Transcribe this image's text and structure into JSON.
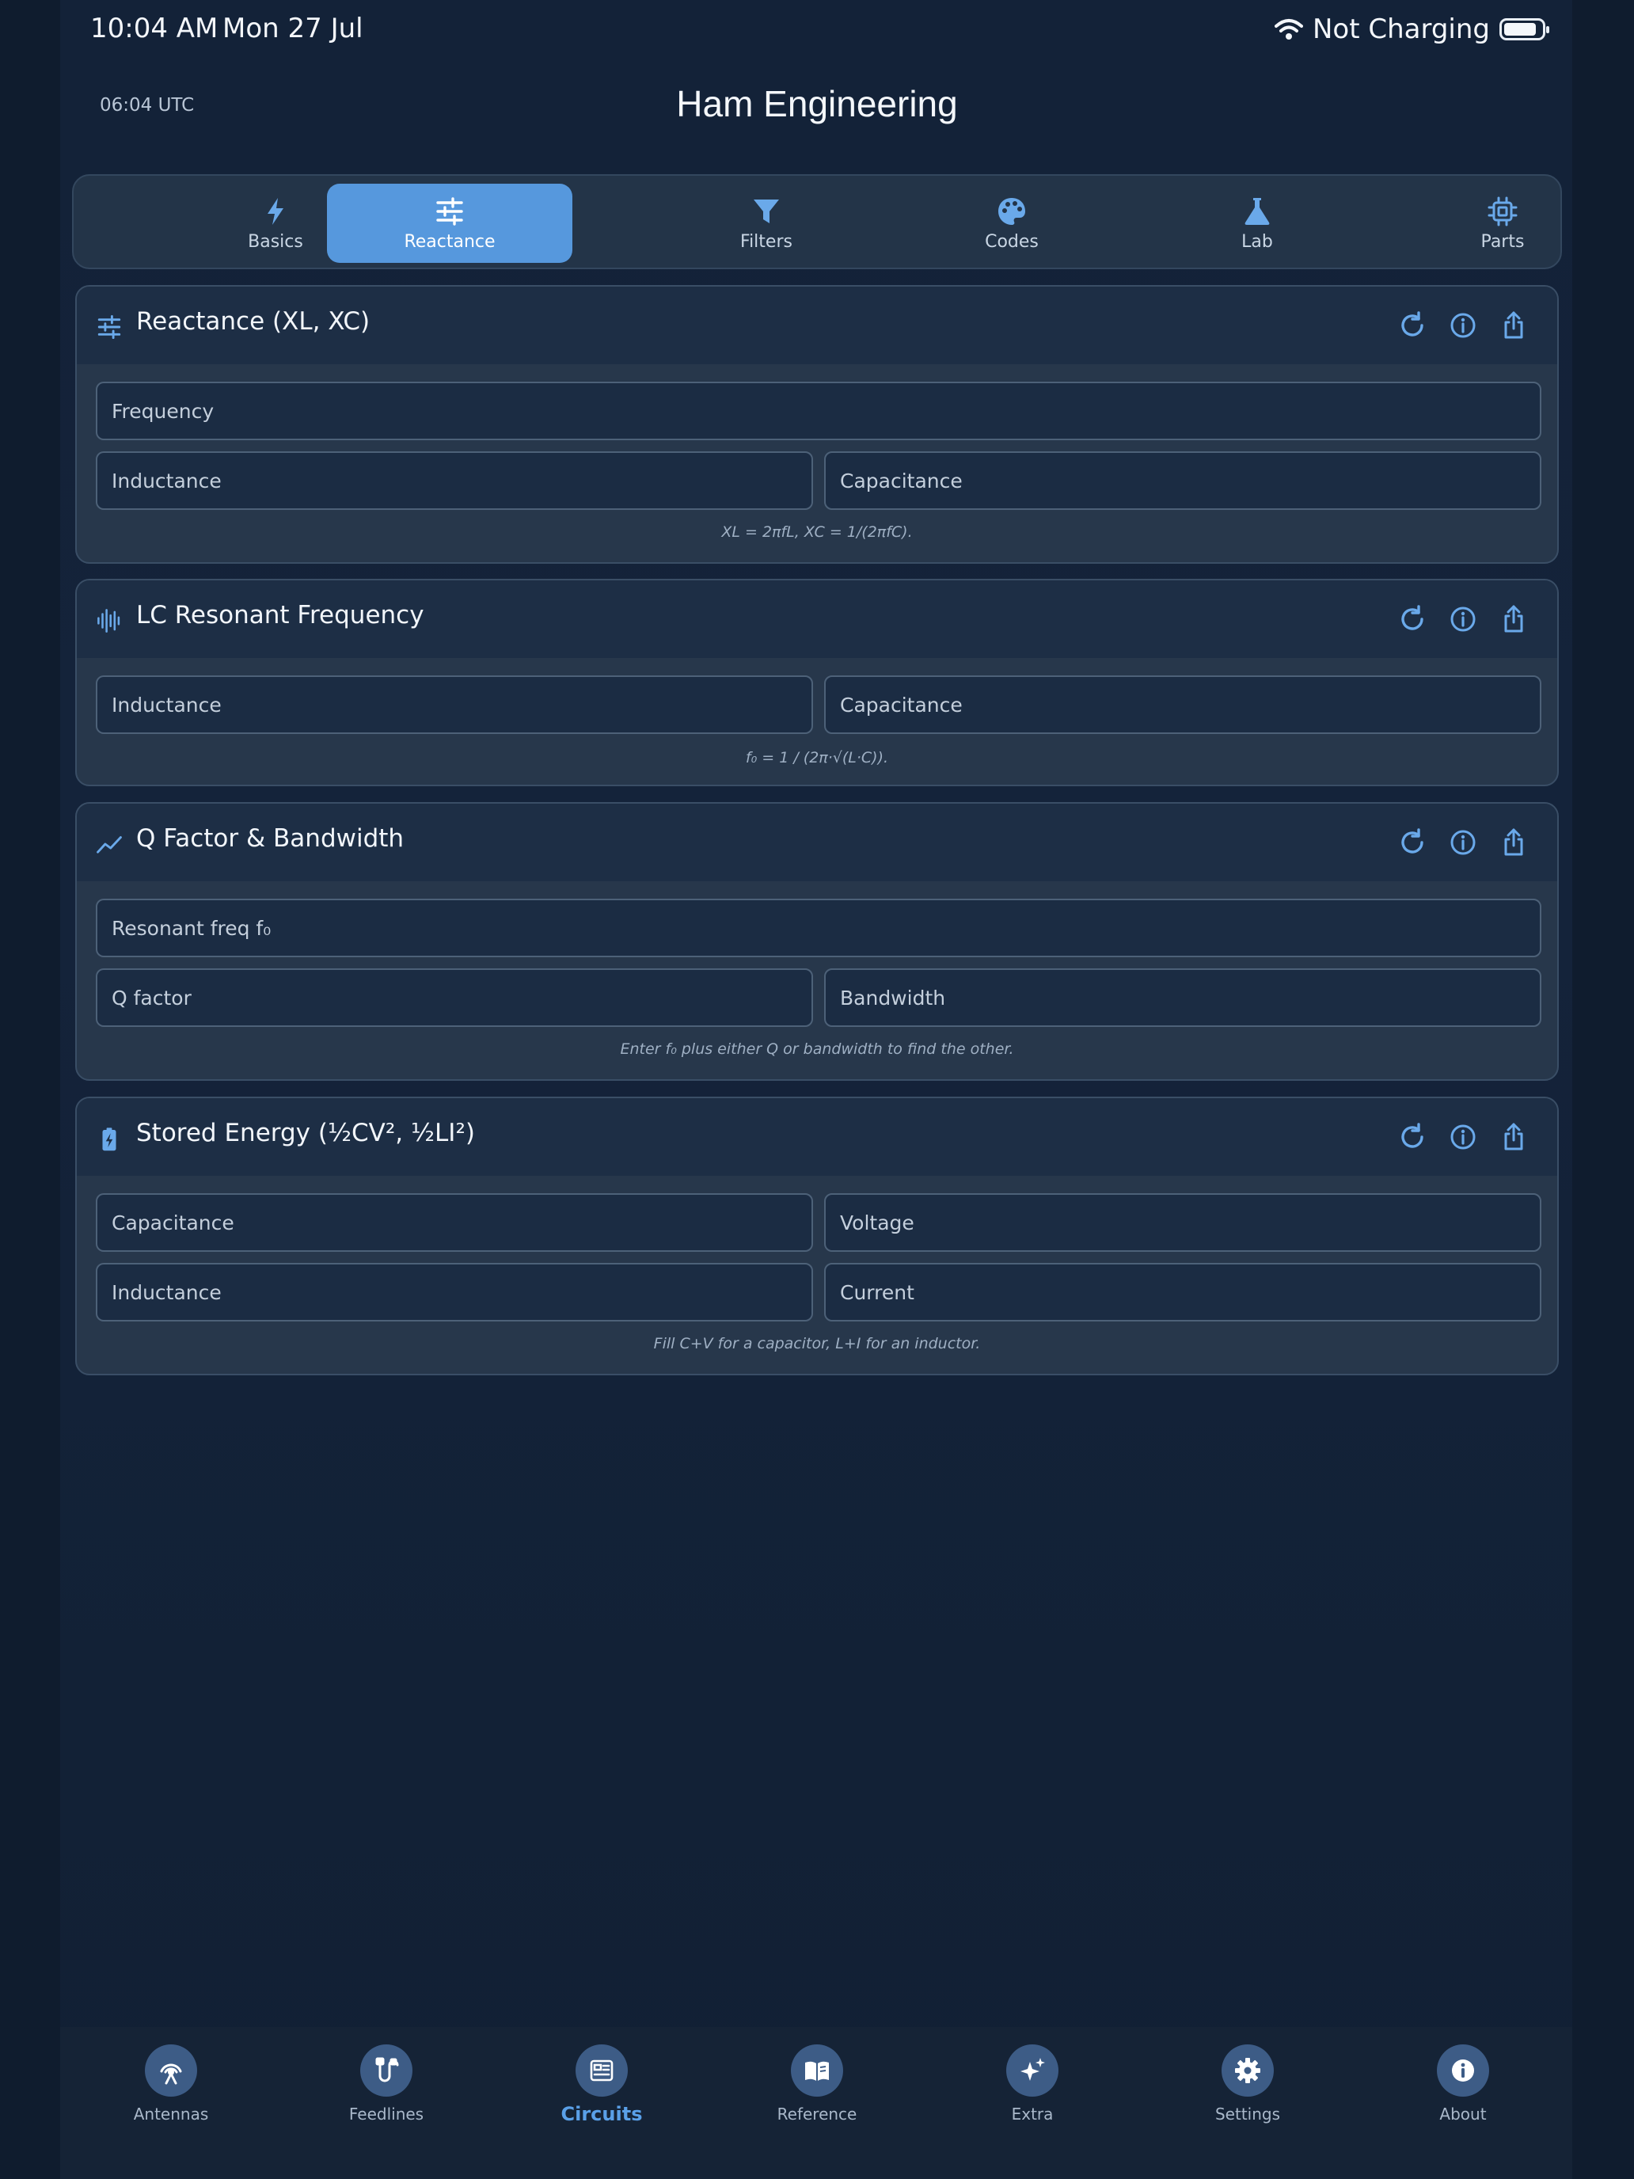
{
  "status_bar": {
    "time": "10:04 AM",
    "date": "Mon 27 Jul",
    "charging": "Not Charging"
  },
  "header": {
    "utc": "06:04 UTC",
    "title": "Ham Engineering"
  },
  "tabs": [
    {
      "label": "Basics",
      "icon": "bolt-icon"
    },
    {
      "label": "Reactance",
      "icon": "sliders-icon",
      "active": true
    },
    {
      "label": "Filters",
      "icon": "funnel-icon"
    },
    {
      "label": "Codes",
      "icon": "palette-icon"
    },
    {
      "label": "Lab",
      "icon": "flask-icon"
    },
    {
      "label": "Parts",
      "icon": "chip-icon"
    }
  ],
  "cards": [
    {
      "title": "Reactance  (XL, XC)",
      "icon": "sliders-icon",
      "fields": [
        "Frequency",
        "Inductance",
        "Capacitance"
      ],
      "hint": "XL = 2πfL,  XC = 1/(2πfC)."
    },
    {
      "title": "LC Resonant Frequency",
      "icon": "waveform-icon",
      "fields": [
        "Inductance",
        "Capacitance"
      ],
      "hint": "f₀ = 1 / (2π·√(L·C))."
    },
    {
      "title": "Q Factor & Bandwidth",
      "icon": "trend-icon",
      "fields": [
        "Resonant freq f₀",
        "Q factor",
        "Bandwidth"
      ],
      "hint": "Enter f₀ plus either Q or bandwidth to find the other."
    },
    {
      "title": "Stored Energy  (½CV², ½LI²)",
      "icon": "battery-bolt-icon",
      "fields": [
        "Capacitance",
        "Voltage",
        "Inductance",
        "Current"
      ],
      "hint": "Fill C+V for a capacitor, L+I for an inductor."
    }
  ],
  "bottom_nav": [
    {
      "label": "Antennas",
      "icon": "antenna-icon"
    },
    {
      "label": "Feedlines",
      "icon": "cable-icon"
    },
    {
      "label": "Circuits",
      "icon": "circuit-board-icon",
      "active": true
    },
    {
      "label": "Reference",
      "icon": "book-icon"
    },
    {
      "label": "Extra",
      "icon": "sparkles-icon"
    },
    {
      "label": "Settings",
      "icon": "gear-icon"
    },
    {
      "label": "About",
      "icon": "info-icon"
    }
  ],
  "colors": {
    "accent": "#5698dd",
    "icon_blue": "#6aa9ea",
    "background": "#0f1c2e"
  }
}
